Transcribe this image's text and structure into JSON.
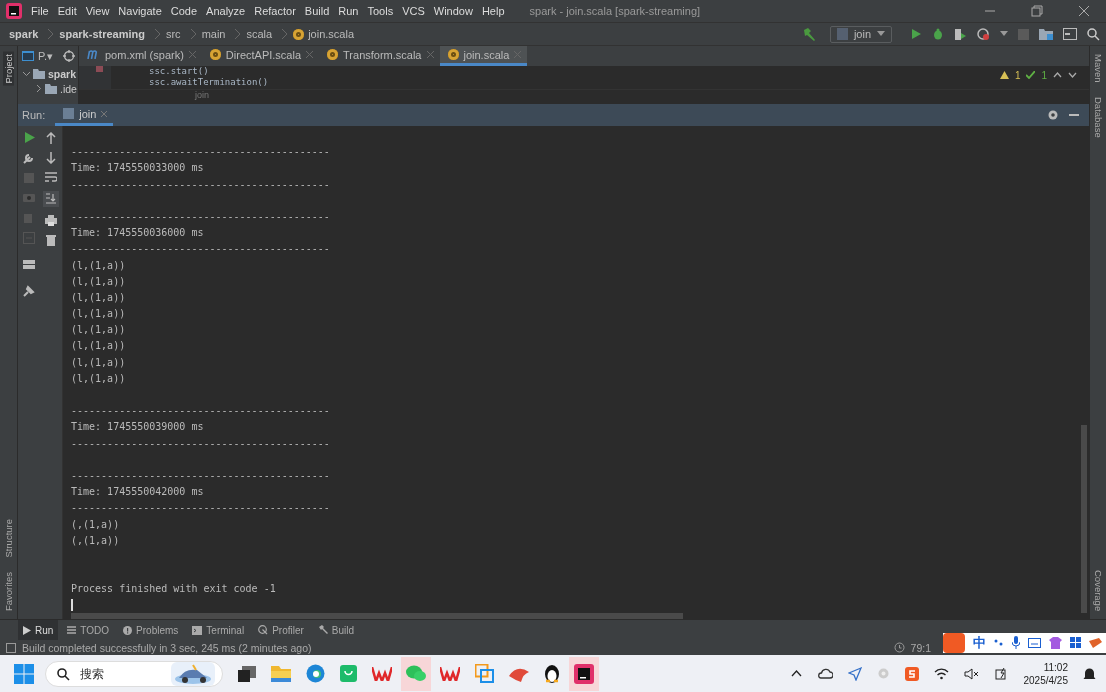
{
  "window": {
    "title": "spark - join.scala [spark-streaming]"
  },
  "menu": [
    "File",
    "Edit",
    "View",
    "Navigate",
    "Code",
    "Analyze",
    "Refactor",
    "Build",
    "Run",
    "Tools",
    "VCS",
    "Window",
    "Help"
  ],
  "breadcrumbs": [
    {
      "label": "spark",
      "bold": true
    },
    {
      "label": "spark-streaming",
      "bold": true
    },
    {
      "label": "src",
      "bold": false
    },
    {
      "label": "main",
      "bold": false
    },
    {
      "label": "scala",
      "bold": false
    },
    {
      "label": "join.scala",
      "bold": false
    }
  ],
  "run_config": "join",
  "project_panel": {
    "label": "P.▾",
    "items": [
      "spark",
      ".ide"
    ]
  },
  "editor_tabs": [
    {
      "label": "pom.xml (spark)",
      "kind": "maven",
      "selected": false
    },
    {
      "label": "DirectAPI.scala",
      "kind": "scala",
      "selected": false
    },
    {
      "label": "Transform.scala",
      "kind": "scala",
      "selected": false
    },
    {
      "label": "join.scala",
      "kind": "scala",
      "selected": true
    }
  ],
  "editor": {
    "lines": [
      "ssc.start()",
      "ssc.awaitTermination()"
    ],
    "inspections": {
      "warnings": "1",
      "ok": "1"
    },
    "breadcrumb": "join"
  },
  "run_panel": {
    "label": "Run:",
    "tab": "join"
  },
  "console": [
    {
      "kind": "blank"
    },
    {
      "kind": "text",
      "text": "-------------------------------------------"
    },
    {
      "kind": "text",
      "text": "Time: 1745550033000 ms"
    },
    {
      "kind": "text",
      "text": "-------------------------------------------"
    },
    {
      "kind": "blank"
    },
    {
      "kind": "text",
      "text": "-------------------------------------------"
    },
    {
      "kind": "text",
      "text": "Time: 1745550036000 ms"
    },
    {
      "kind": "text",
      "text": "-------------------------------------------"
    },
    {
      "kind": "text",
      "text": "(l,(1,a))"
    },
    {
      "kind": "text",
      "text": "(l,(1,a))"
    },
    {
      "kind": "text",
      "text": "(l,(1,a))"
    },
    {
      "kind": "text",
      "text": "(l,(1,a))"
    },
    {
      "kind": "text",
      "text": "(l,(1,a))"
    },
    {
      "kind": "text",
      "text": "(l,(1,a))"
    },
    {
      "kind": "text",
      "text": "(l,(1,a))"
    },
    {
      "kind": "text",
      "text": "(l,(1,a))"
    },
    {
      "kind": "blank"
    },
    {
      "kind": "text",
      "text": "-------------------------------------------"
    },
    {
      "kind": "text",
      "text": "Time: 1745550039000 ms"
    },
    {
      "kind": "text",
      "text": "-------------------------------------------"
    },
    {
      "kind": "blank"
    },
    {
      "kind": "text",
      "text": "-------------------------------------------"
    },
    {
      "kind": "text",
      "text": "Time: 1745550042000 ms"
    },
    {
      "kind": "text",
      "text": "-------------------------------------------"
    },
    {
      "kind": "text",
      "text": "(,(1,a))"
    },
    {
      "kind": "text",
      "text": "(,(1,a))"
    },
    {
      "kind": "blank"
    },
    {
      "kind": "blank"
    },
    {
      "kind": "text",
      "text": "Process finished with exit code -1"
    },
    {
      "kind": "cursor"
    }
  ],
  "side_left": [
    {
      "label": "Project",
      "selected": true
    },
    {
      "label": "Structure",
      "selected": false
    },
    {
      "label": "Favorites",
      "selected": false
    }
  ],
  "side_right": [
    "Maven",
    "Database",
    "Coverage"
  ],
  "bottom_tabs": [
    {
      "label": "Run",
      "kind": "run",
      "selected": true
    },
    {
      "label": "TODO",
      "kind": "list",
      "selected": false
    },
    {
      "label": "Problems",
      "kind": "info",
      "selected": false
    },
    {
      "label": "Terminal",
      "kind": "terminal",
      "selected": false
    },
    {
      "label": "Profiler",
      "kind": "profiler",
      "selected": false
    },
    {
      "label": "Build",
      "kind": "build",
      "selected": false
    }
  ],
  "status_bar": {
    "message": "Build completed successfully in 3 sec, 245 ms (2 minutes ago)",
    "position": "79:1"
  },
  "ime": {
    "mode": "中"
  },
  "taskbar": {
    "search_placeholder": "搜索",
    "time": "11:02",
    "date": "2025/4/25"
  }
}
